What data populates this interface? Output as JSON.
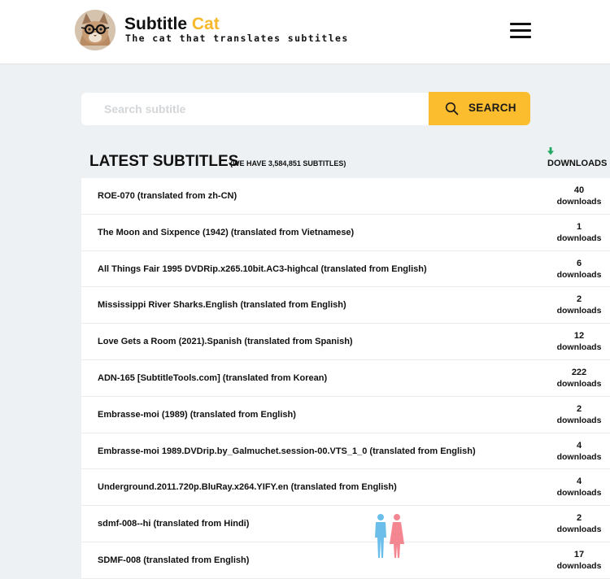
{
  "header": {
    "brand_main": "Subtitle",
    "brand_accent": "Cat",
    "tagline": "The cat that translates subtitles",
    "logo_icon": "cat-avatar-icon",
    "menu_icon": "hamburger-menu-icon"
  },
  "search": {
    "placeholder": "Search subtitle",
    "value": "",
    "button_label": "SEARCH",
    "button_color": "#fbbd2e"
  },
  "latest": {
    "title": "LATEST SUBTITLES",
    "count_text": "(WE HAVE 3,584,851 SUBTITLES)",
    "downloads_header": "DOWNLOADS",
    "sort_icon": "arrow-down-icon",
    "sort_icon_color": "#21a861",
    "rows": [
      {
        "title": "ROE-070 (translated from zh-CN)",
        "count": "40",
        "unit": "downloads"
      },
      {
        "title": "The Moon and Sixpence (1942) (translated from Vietnamese)",
        "count": "1",
        "unit": "downloads"
      },
      {
        "title": "All Things Fair 1995 DVDRip.x265.10bit.AC3-highcal (translated from English)",
        "count": "6",
        "unit": "downloads"
      },
      {
        "title": "Mississippi River Sharks.English (translated from English)",
        "count": "2",
        "unit": "downloads"
      },
      {
        "title": "Love Gets a Room (2021).Spanish (translated from Spanish)",
        "count": "12",
        "unit": "downloads"
      },
      {
        "title": "ADN-165 [SubtitleTools.com] (translated from Korean)",
        "count": "222",
        "unit": "downloads"
      },
      {
        "title": "Embrasse-moi (1989) (translated from English)",
        "count": "2",
        "unit": "downloads"
      },
      {
        "title": "Embrasse-moi 1989.DVDrip.by_Galmuchet.session-00.VTS_1_0 (translated from English)",
        "count": "4",
        "unit": "downloads"
      },
      {
        "title": "Underground.2011.720p.BluRay.x264.YIFY.en (translated from English)",
        "count": "4",
        "unit": "downloads"
      },
      {
        "title": "sdmf-008--hi (translated from Hindi)",
        "count": "2",
        "unit": "downloads"
      },
      {
        "title": "SDMF-008 (translated from English)",
        "count": "17",
        "unit": "downloads"
      }
    ]
  },
  "overlay": {
    "figures_icon": "people-figures-icon",
    "colors": [
      "#5bb8e8",
      "#f27a86"
    ]
  }
}
